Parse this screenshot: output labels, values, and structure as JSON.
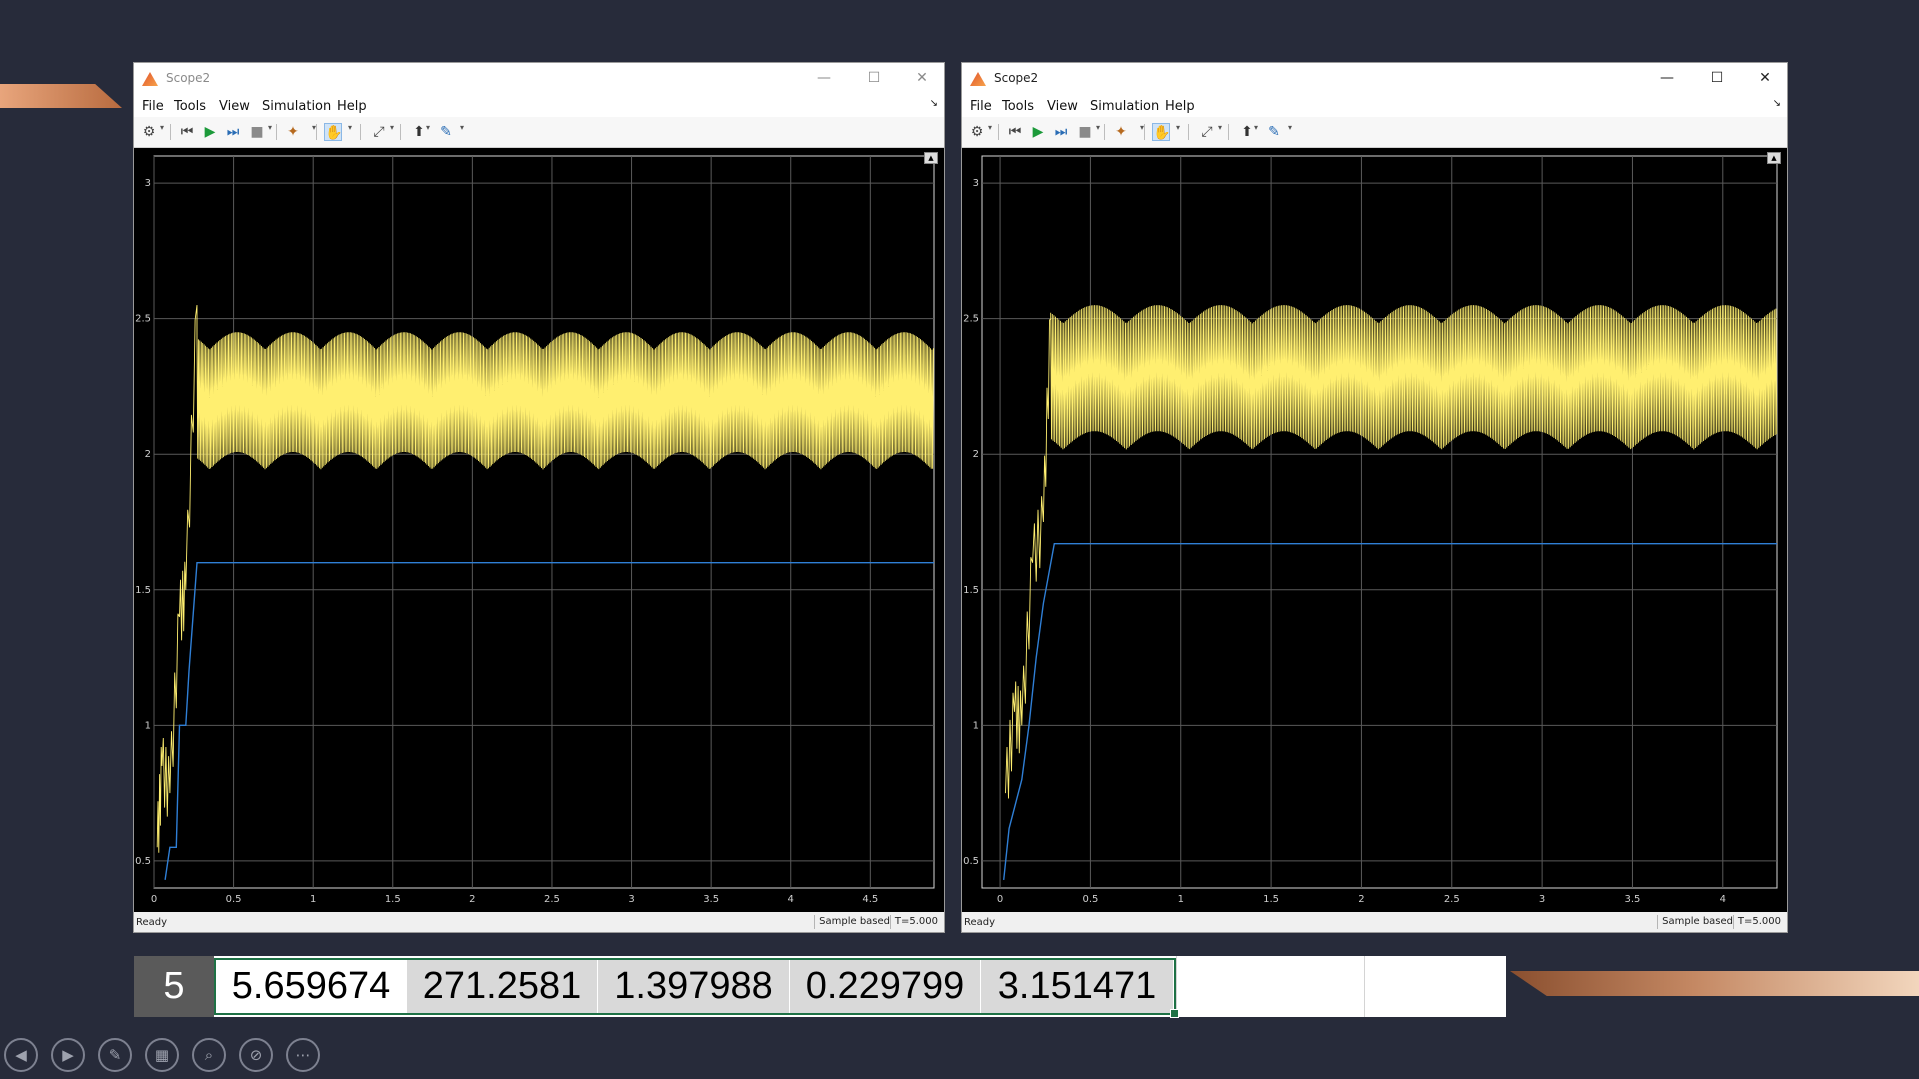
{
  "scopes": [
    {
      "title": "Scope2",
      "active": false,
      "menu": [
        "File",
        "Tools",
        "View",
        "Simulation",
        "Help"
      ],
      "window_buttons": {
        "minimize": "—",
        "maximize": "☐",
        "close": "✕"
      },
      "status": {
        "left": "Ready",
        "mode": "Sample based",
        "time": "T=5.000"
      },
      "chart": {
        "type": "line",
        "xlim": [
          0,
          4.9
        ],
        "ylim": [
          0.4,
          3.1
        ],
        "xticks": [
          0,
          0.5,
          1,
          1.5,
          2,
          2.5,
          3,
          3.5,
          4,
          4.5
        ],
        "xtick_labels": [
          "0",
          "0.5",
          "1",
          "1.5",
          "2",
          "2.5",
          "3",
          "3.5",
          "4",
          "4.5"
        ],
        "yticks": [
          0.5,
          1,
          1.5,
          2,
          2.5,
          3
        ],
        "ytick_labels": [
          "0.5",
          "1",
          "1.5",
          "2",
          "2.5",
          "3"
        ],
        "grid": true,
        "series": [
          {
            "color": "#ffef70",
            "steady_min": 1.88,
            "steady_max": 2.45,
            "steady_start": 0.27,
            "transient": [
              [
                0.02,
                0.55
              ],
              [
                0.05,
                0.85
              ],
              [
                0.1,
                0.75
              ],
              [
                0.16,
                1.4
              ],
              [
                0.2,
                1.5
              ],
              [
                0.27,
                2.55
              ]
            ]
          },
          {
            "color": "#2f7fd6",
            "points": [
              [
                0.07,
                0.43
              ],
              [
                0.1,
                0.55
              ],
              [
                0.14,
                0.55
              ],
              [
                0.16,
                1.0
              ],
              [
                0.2,
                1.0
              ],
              [
                0.22,
                1.2
              ],
              [
                0.27,
                1.6
              ],
              [
                4.9,
                1.6
              ]
            ]
          }
        ]
      }
    },
    {
      "title": "Scope2",
      "active": true,
      "menu": [
        "File",
        "Tools",
        "View",
        "Simulation",
        "Help"
      ],
      "window_buttons": {
        "minimize": "—",
        "maximize": "☐",
        "close": "✕"
      },
      "status": {
        "left": "Ready",
        "mode": "Sample based",
        "time": "T=5.000"
      },
      "chart": {
        "type": "line",
        "xlim": [
          -0.1,
          4.3
        ],
        "ylim": [
          0.4,
          3.1
        ],
        "xticks": [
          0,
          0.5,
          1,
          1.5,
          2,
          2.5,
          3,
          3.5,
          4
        ],
        "xtick_labels": [
          "0",
          "0.5",
          "1",
          "1.5",
          "2",
          "2.5",
          "3",
          "3.5",
          "4"
        ],
        "yticks": [
          0.5,
          1,
          1.5,
          2,
          2.5,
          3
        ],
        "ytick_labels": [
          "0.5",
          "1",
          "1.5",
          "2",
          "2.5",
          "3"
        ],
        "grid": true,
        "series": [
          {
            "color": "#ffef70",
            "steady_min": 1.95,
            "steady_max": 2.55,
            "steady_start": 0.28,
            "transient": [
              [
                0.03,
                0.75
              ],
              [
                0.08,
                1.05
              ],
              [
                0.12,
                1.0
              ],
              [
                0.18,
                1.6
              ],
              [
                0.24,
                1.75
              ],
              [
                0.28,
                2.5
              ]
            ]
          },
          {
            "color": "#2f7fd6",
            "points": [
              [
                0.02,
                0.43
              ],
              [
                0.05,
                0.62
              ],
              [
                0.12,
                0.8
              ],
              [
                0.16,
                1.0
              ],
              [
                0.2,
                1.25
              ],
              [
                0.24,
                1.45
              ],
              [
                0.3,
                1.67
              ],
              [
                4.3,
                1.67
              ]
            ]
          }
        ]
      }
    }
  ],
  "spreadsheet": {
    "row_number": "5",
    "cells": [
      "5.659674",
      "271.2581",
      "1.397988",
      "0.229799",
      "3.151471"
    ]
  },
  "presentation_controls": [
    "previous-icon",
    "next-icon",
    "pen-icon",
    "slides-grid-icon",
    "zoom-icon",
    "camera-off-icon",
    "more-icon"
  ],
  "presentation_glyphs": [
    "◀",
    "▶",
    "✎",
    "▦",
    "⌕",
    "⊘",
    "⋯"
  ]
}
